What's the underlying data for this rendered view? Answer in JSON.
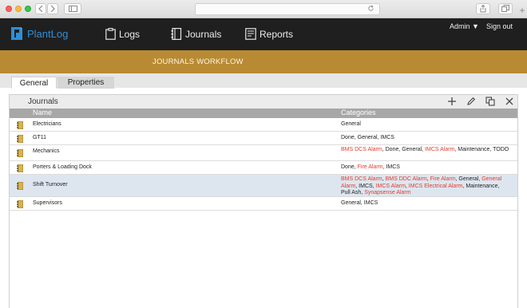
{
  "browser": {
    "back_icon": "chevron-left-icon",
    "forward_icon": "chevron-right-icon",
    "sidebar_icon": "sidebar-icon",
    "reload_icon": "reload-icon",
    "share_icon": "share-icon",
    "tabs_icon": "tabs-icon",
    "new_tab_glyph": "+"
  },
  "header": {
    "app_name": "PlantLog",
    "nav": [
      {
        "label": "Logs",
        "icon": "clipboard-icon"
      },
      {
        "label": "Journals",
        "icon": "book-icon"
      },
      {
        "label": "Reports",
        "icon": "report-icon"
      }
    ],
    "user_menu": "Admin ▼",
    "sign_out": "Sign out"
  },
  "banner": {
    "title": "JOURNALS WORKFLOW"
  },
  "tabs": [
    {
      "label": "General",
      "active": true
    },
    {
      "label": "Properties",
      "active": false
    }
  ],
  "panel": {
    "title": "Journals",
    "actions": [
      "add-icon",
      "edit-icon",
      "copy-icon",
      "close-icon"
    ],
    "columns": {
      "name": "Name",
      "categories": "Categories"
    },
    "rows": [
      {
        "name": "Electricians",
        "categories": [
          {
            "t": "General",
            "alarm": false
          }
        ]
      },
      {
        "name": "GT11",
        "categories": [
          {
            "t": "Done, General, IMCS",
            "alarm": false
          }
        ]
      },
      {
        "name": "Mechanics",
        "categories": [
          {
            "t": "BMS DCS Alarm",
            "alarm": true
          },
          {
            "t": ", Done, General, ",
            "alarm": false
          },
          {
            "t": "IMCS Alarm",
            "alarm": true
          },
          {
            "t": ", Maintenance, TODO",
            "alarm": false
          }
        ]
      },
      {
        "name": "Porters & Loading Dock",
        "categories": [
          {
            "t": "Done, ",
            "alarm": false
          },
          {
            "t": "Fire Alarm",
            "alarm": true
          },
          {
            "t": ", IMCS",
            "alarm": false
          }
        ]
      },
      {
        "name": "Shift Turnover",
        "selected": true,
        "categories": [
          {
            "t": "BMS DCS Alarm",
            "alarm": true
          },
          {
            "t": ", ",
            "alarm": false
          },
          {
            "t": "BMS DDC Alarm",
            "alarm": true
          },
          {
            "t": ", ",
            "alarm": false
          },
          {
            "t": "Fire Alarm",
            "alarm": true
          },
          {
            "t": ", General, ",
            "alarm": false
          },
          {
            "t": "General Alarm",
            "alarm": true
          },
          {
            "t": ", IMCS, ",
            "alarm": false
          },
          {
            "t": "IMCS Alarm",
            "alarm": true
          },
          {
            "t": ", ",
            "alarm": false
          },
          {
            "t": "IMCS Electrical Alarm",
            "alarm": true
          },
          {
            "t": ", Maintenance, Pull Ash, ",
            "alarm": false
          },
          {
            "t": "Synapsense Alarm",
            "alarm": true
          }
        ]
      },
      {
        "name": "Supervisors",
        "categories": [
          {
            "t": "General, IMCS",
            "alarm": false
          }
        ]
      }
    ]
  },
  "colors": {
    "topbar": "#1f1f1f",
    "banner": "#b88a33",
    "brand": "#2e8fd6",
    "alarm": "#e23b2f",
    "selected_row": "#dde6ef",
    "column_header": "#a7a7a7"
  }
}
